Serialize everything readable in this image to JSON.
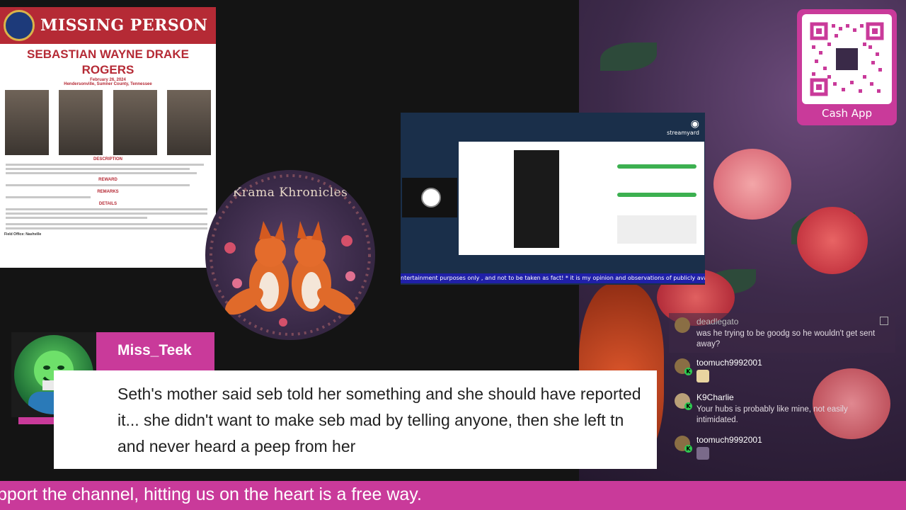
{
  "flyer": {
    "title": "MISSING PERSON",
    "name": "SEBASTIAN WAYNE DRAKE ROGERS",
    "date": "February 26, 2024",
    "location": "Hendersonville, Sumner County, Tennessee",
    "description_header": "DESCRIPTION",
    "reward_header": "REWARD",
    "remarks_header": "REMARKS",
    "details_header": "DETAILS",
    "field_office": "Field Office: Nashville"
  },
  "krama": {
    "title": "Krama Khronicles"
  },
  "stream": {
    "brand": "streamyard",
    "ticker": "ntertainment purposes only , and not to be taken as fact! * it is my opinion and observations of publicly avail"
  },
  "cashapp": {
    "label": "Cash App"
  },
  "chat": {
    "messages": [
      {
        "user": "deadlegato",
        "text": "was he trying to be goodg so he wouldn't get sent away?"
      },
      {
        "user": "toomuch9992001",
        "text": ""
      },
      {
        "user": "K9Charlie",
        "text": "Your hubs is probably like mine, not easily intimidated."
      },
      {
        "user": "toomuch9992001",
        "text": ""
      }
    ]
  },
  "featured_comment": {
    "username": "Miss_Teek",
    "badge": "K",
    "text": "Seth's mother said seb told her something and she should have reported it... she didn't want to make seb mad by telling anyone, then she left tn and never heard a peep from her"
  },
  "ticker": {
    "text": "pport the channel, hitting us on the heart is a free way."
  },
  "colors": {
    "accent": "#c93a9a",
    "flyer_red": "#b52a35",
    "kick_green": "#2ec850"
  }
}
